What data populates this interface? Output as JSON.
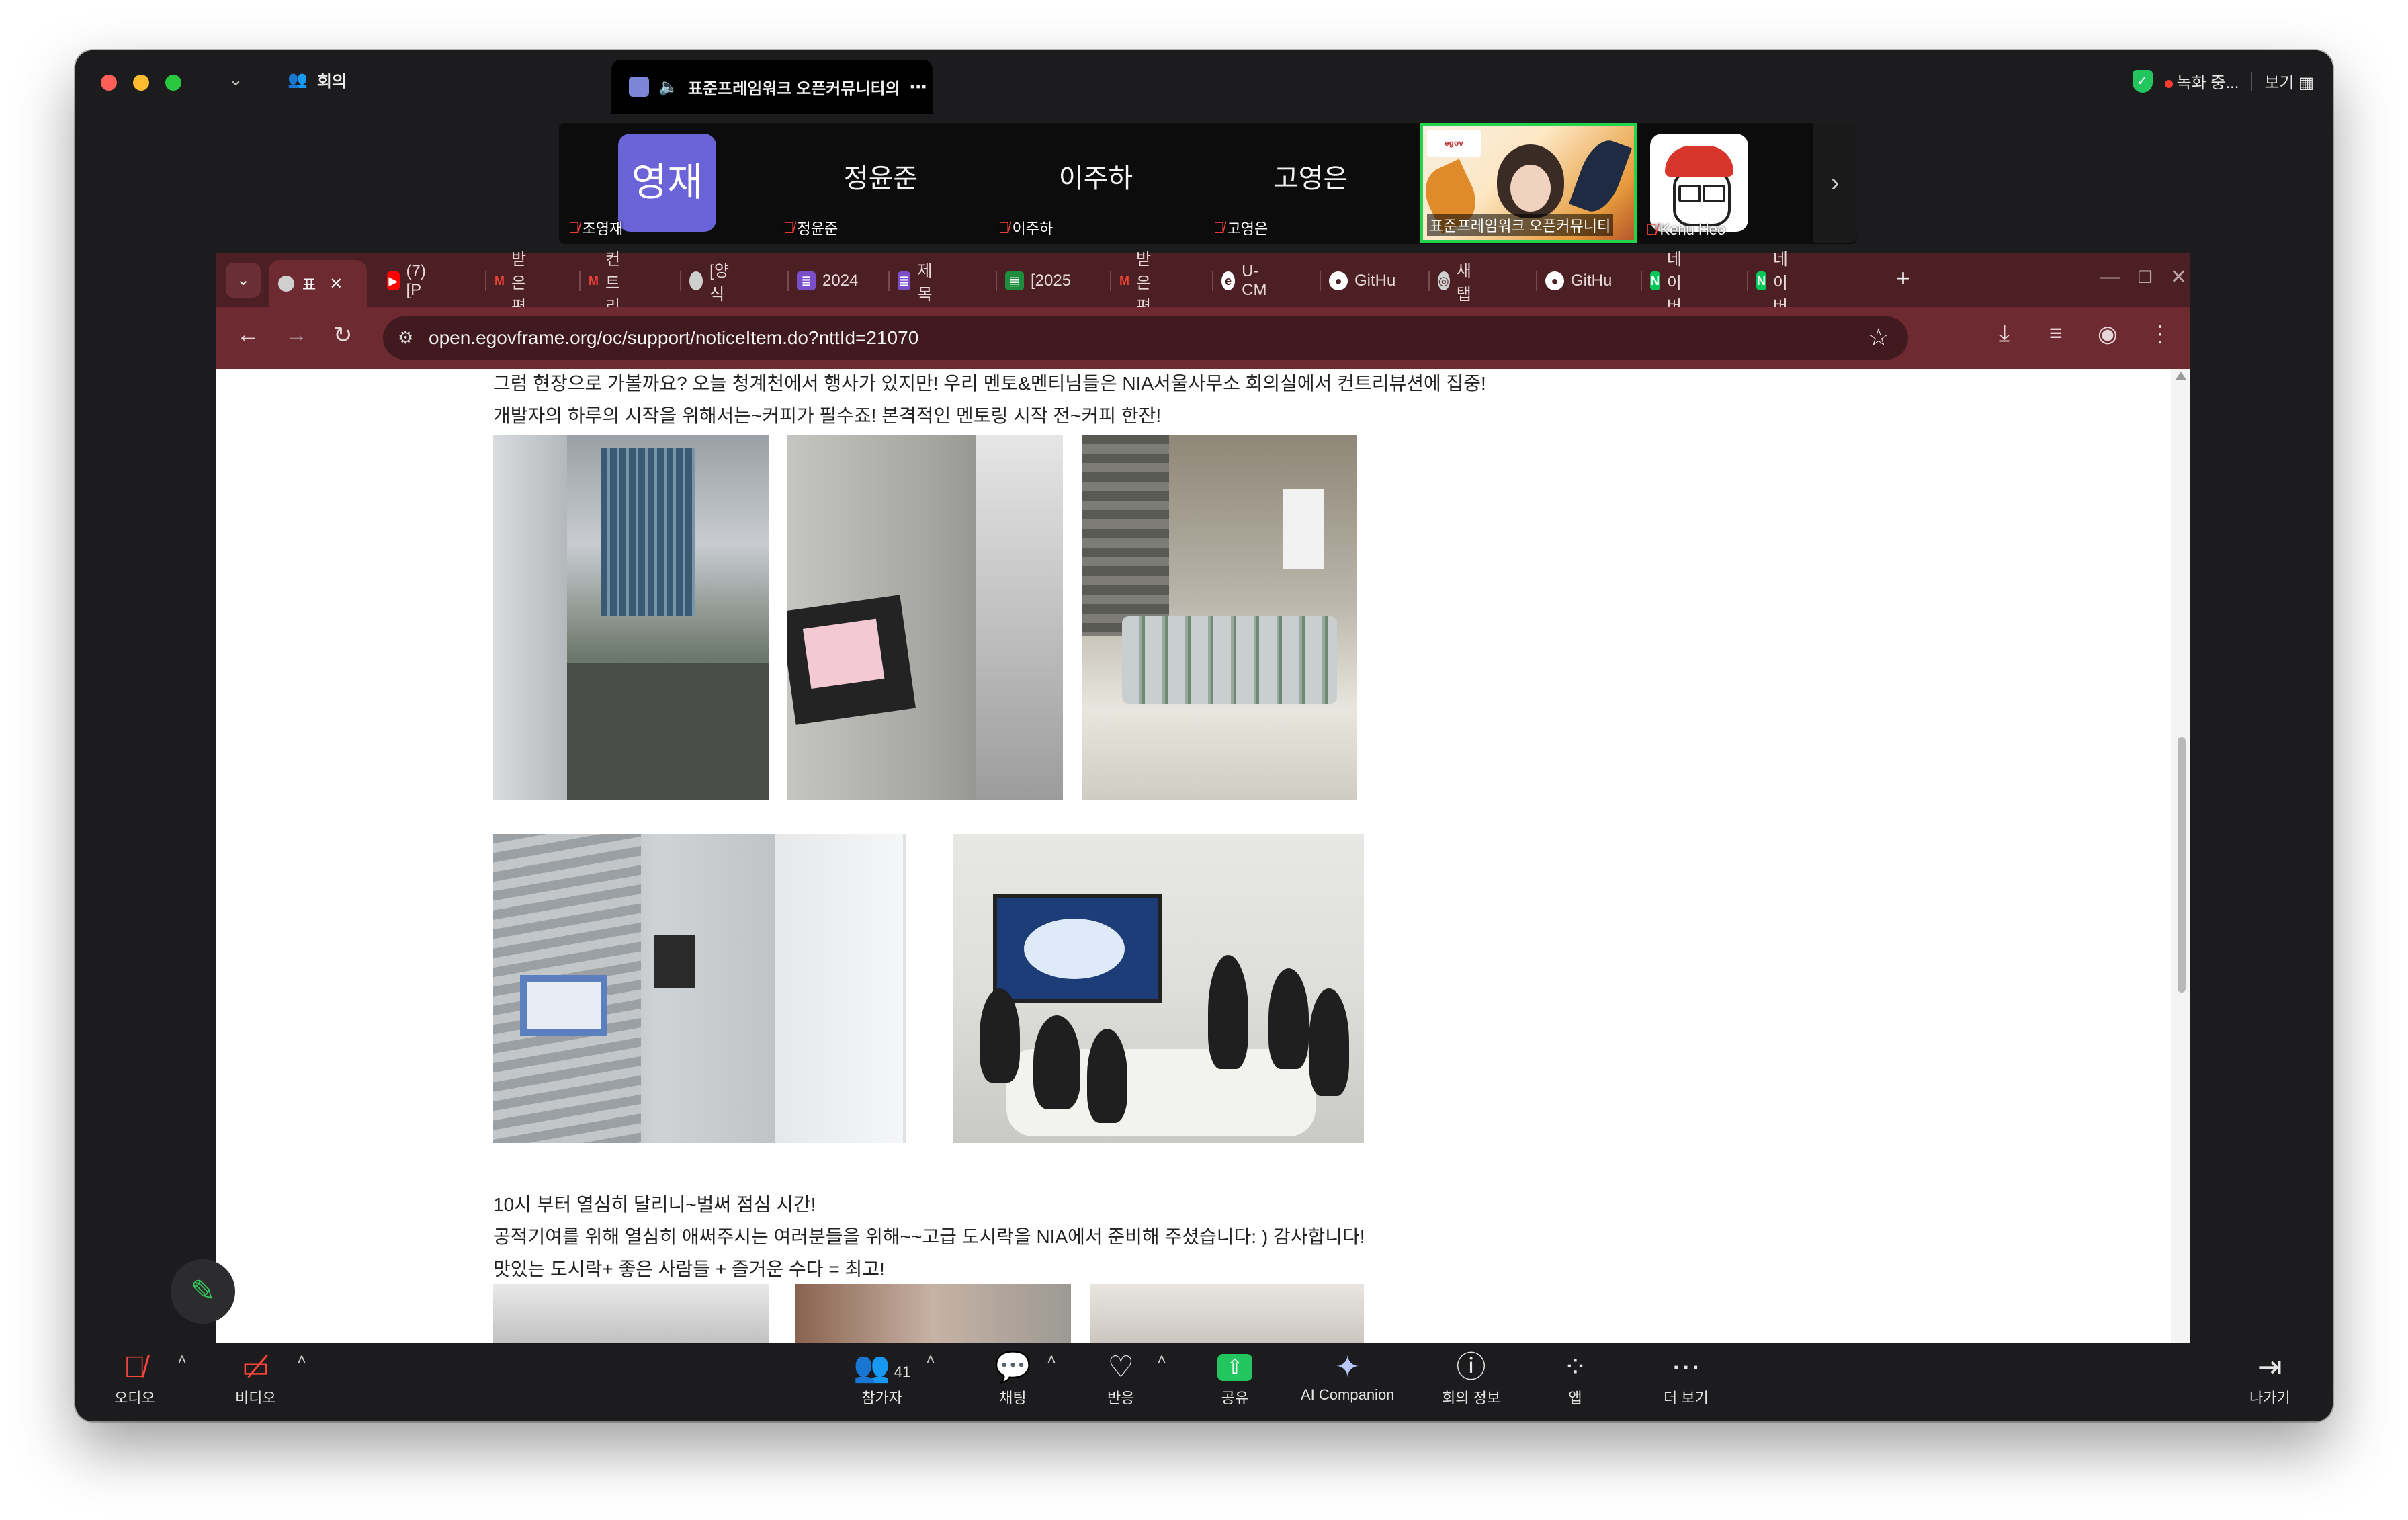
{
  "zoom": {
    "meeting_label": "회의",
    "tab_title": "표준프레임워크 오픈커뮤니티의",
    "recording": "녹화 중...",
    "view_label": "보기",
    "participants_strip": [
      {
        "avatar": "영재",
        "label": "조영재"
      },
      {
        "name": "정윤준",
        "label": "정윤준"
      },
      {
        "name": "이주하",
        "label": "이주하"
      },
      {
        "name": "고영은",
        "label": "고영은"
      }
    ],
    "active_speaker_label": "표준프레임워크 오픈커뮤니티",
    "kenu_label": "Kenu Heo",
    "controls": {
      "audio": "오디오",
      "video": "비디오",
      "participants": "참가자",
      "participants_count": "41",
      "chat": "채팅",
      "reactions": "반응",
      "share": "공유",
      "ai": "AI Companion",
      "info": "회의 정보",
      "apps": "앱",
      "more": "더 보기",
      "leave": "나가기"
    }
  },
  "browser": {
    "active_tab": "표",
    "tabs": [
      {
        "label": "(7) [P",
        "icon": "youtube-icon",
        "color": "#ff0000"
      },
      {
        "label": "받은편",
        "icon": "gmail-icon",
        "color": "#ea4335"
      },
      {
        "label": "컨트리",
        "icon": "gmail-icon",
        "color": "#ea4335"
      },
      {
        "label": "[양식",
        "icon": "globe-icon",
        "color": "#cfcfcf"
      },
      {
        "label": "2024",
        "icon": "forms-icon",
        "color": "#7b4fc9"
      },
      {
        "label": "제목",
        "icon": "forms-icon",
        "color": "#7b4fc9"
      },
      {
        "label": "[2025",
        "icon": "sheets-icon",
        "color": "#1e8e3e"
      },
      {
        "label": "받은편",
        "icon": "gmail-icon",
        "color": "#ea4335"
      },
      {
        "label": "U-CM",
        "icon": "edge-icon",
        "color": "#ffffff"
      },
      {
        "label": "GitHu",
        "icon": "github-icon",
        "color": "#ffffff"
      },
      {
        "label": "새 탭",
        "icon": "chrome-icon",
        "color": "#cfcfcf"
      },
      {
        "label": "GitHu",
        "icon": "github-icon",
        "color": "#ffffff"
      },
      {
        "label": "네이버",
        "icon": "naver-icon",
        "color": "#03c75a"
      },
      {
        "label": "네이버",
        "icon": "naver-icon",
        "color": "#03c75a"
      }
    ],
    "url": "open.egovframe.org/oc/support/noticeItem.do?nttId=21070"
  },
  "page": {
    "para1_line1": "그럼 현장으로 가볼까요? 오늘 청계천에서 행사가 있지만! 우리 멘토&멘티님들은 NIA서울사무소 회의실에서 컨트리뷰션에 집중!",
    "para1_line2": "개발자의 하루의 시작을 위해서는~커피가 필수죠! 본격적인 멘토링 시작 전~커피 한잔!",
    "para2_line1": "10시 부터 열심히 달리니~벌써 점심 시간!",
    "para2_line2": "공적기여를 위해 열심히 애써주시는 여러분들을 위해~~고급 도시락을 NIA에서 준비해 주셨습니다: ) 감사합니다!",
    "para2_line3": "맛있는 도시락+ 좋은 사람들 + 즐거운 수다 = 최고!"
  }
}
